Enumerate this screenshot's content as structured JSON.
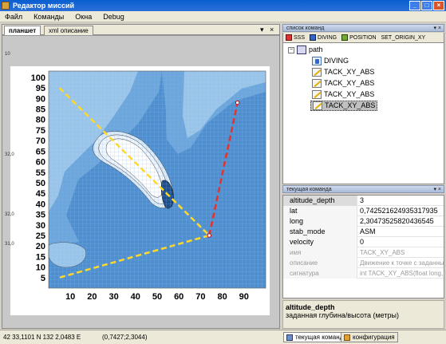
{
  "window": {
    "title": "Редактор миссий",
    "buttons": [
      "_",
      "□",
      "×"
    ]
  },
  "menu": {
    "items": [
      "Файл",
      "Команды",
      "Окна",
      "Debug"
    ]
  },
  "document_tabs": {
    "tabs": [
      "планшет",
      "xml описание"
    ],
    "active": "планшет",
    "pin_glyph": "▾",
    "close_glyph": "×"
  },
  "map": {
    "x_ticks": [
      "10",
      "20",
      "30",
      "40",
      "50",
      "60",
      "70",
      "80",
      "90"
    ],
    "y_ticks": [
      "5",
      "10",
      "15",
      "20",
      "25",
      "30",
      "35",
      "40",
      "45",
      "50",
      "55",
      "60",
      "65",
      "70",
      "75",
      "80",
      "85",
      "90",
      "95",
      "100"
    ],
    "side_labels": [
      "10",
      "32,0",
      "32,0",
      "31,0"
    ],
    "colors": {
      "water_deep": "#4f8fcf",
      "water_mid": "#6da6dc",
      "water_shallow": "#9cc6ea",
      "land": "#ffffff",
      "path_yellow": "#ffd92a",
      "path_red": "#e8312a"
    },
    "path_yellow": [
      [
        5,
        95
      ],
      [
        74,
        25
      ],
      [
        5,
        5
      ]
    ],
    "path_red": [
      [
        74,
        25
      ],
      [
        87,
        88
      ]
    ]
  },
  "commands_panel": {
    "title": "список команд",
    "controls": "▾ ×",
    "toolbar": [
      {
        "label": "SSS",
        "icon": "sss-icon"
      },
      {
        "label": "DIVING",
        "icon": "diving-icon"
      },
      {
        "label": "POSITION",
        "icon": "position-icon"
      },
      {
        "label": "SET_ORIGIN_XY",
        "icon": "set-origin-icon"
      }
    ],
    "tree": {
      "root": "path",
      "root_expander": "−",
      "children": [
        "DIVING",
        "TACK_XY_ABS",
        "TACK_XY_ABS",
        "TACK_XY_ABS",
        "TACK_XY_ABS"
      ],
      "selected_index": 4
    }
  },
  "current_command_panel": {
    "title": "текущая команда",
    "controls": "▾ ×",
    "properties": [
      {
        "key": "altitude_depth",
        "value": "3",
        "readonly": false,
        "highlight": true
      },
      {
        "key": "lat",
        "value": "0,742521624935317935",
        "readonly": false
      },
      {
        "key": "long",
        "value": "2,30473525820436545",
        "readonly": false
      },
      {
        "key": "stab_mode",
        "value": "ASM",
        "readonly": false
      },
      {
        "key": "velocity",
        "value": "0",
        "readonly": false
      },
      {
        "key": "имя",
        "value": "TACK_XY_ABS",
        "readonly": true
      },
      {
        "key": "описание",
        "value": "Движение к точке с заданными",
        "readonly": true
      },
      {
        "key": "сигнатура",
        "value": "int TACK_XY_ABS(float long, float",
        "readonly": true
      }
    ],
    "description_title": "altitude_depth",
    "description_text": "заданная глубина/высота (метры)"
  },
  "statusbar": {
    "coords": "42 33,1101 N 132 2,0483 E",
    "local": "(0,7427;2,3044)",
    "bottom_tabs": [
      "текущая команда",
      "конфигурация"
    ]
  }
}
